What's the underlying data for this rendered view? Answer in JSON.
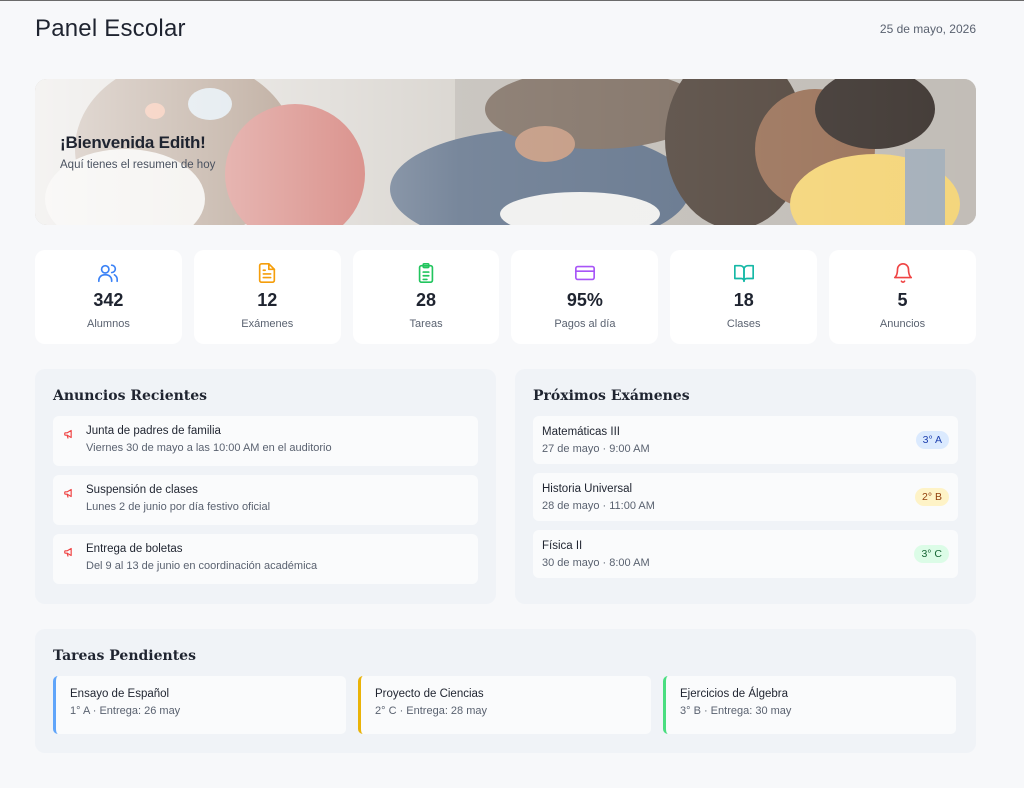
{
  "header": {
    "title": "Panel Escolar",
    "date": "25 de mayo, 2026"
  },
  "hero": {
    "title": "¡Bienvenida Edith!",
    "subtitle": "Aquí tienes el resumen de hoy"
  },
  "stats": [
    {
      "icon": "users-icon",
      "value": "342",
      "label": "Alumnos",
      "color": "#3b82f6"
    },
    {
      "icon": "document-icon",
      "value": "12",
      "label": "Exámenes",
      "color": "#f59e0b"
    },
    {
      "icon": "clipboard-icon",
      "value": "28",
      "label": "Tareas",
      "color": "#22c55e"
    },
    {
      "icon": "credit-card-icon",
      "value": "95%",
      "label": "Pagos al día",
      "color": "#a855f7"
    },
    {
      "icon": "book-icon",
      "value": "18",
      "label": "Clases",
      "color": "#14b8a6"
    },
    {
      "icon": "bell-icon",
      "value": "5",
      "label": "Anuncios",
      "color": "#ef4444"
    }
  ],
  "announcements": {
    "title": "Anuncios Recientes",
    "icon": "megaphone-icon",
    "icon_color": "#ef4444",
    "items": [
      {
        "title": "Junta de padres de familia",
        "detail": "Viernes 30 de mayo a las 10:00 AM en el auditorio"
      },
      {
        "title": "Suspensión de clases",
        "detail": "Lunes 2 de junio por día festivo oficial"
      },
      {
        "title": "Entrega de boletas",
        "detail": "Del 9 al 13 de junio en coordinación académica"
      }
    ]
  },
  "exams": {
    "title": "Próximos Exámenes",
    "items": [
      {
        "subject": "Matemáticas III",
        "when": "27 de mayo · 9:00 AM",
        "group": "3° A",
        "badge_bg": "#dbeafe",
        "badge_fg": "#1e40af"
      },
      {
        "subject": "Historia Universal",
        "when": "28 de mayo · 11:00 AM",
        "group": "2° B",
        "badge_bg": "#fef3c7",
        "badge_fg": "#92400e"
      },
      {
        "subject": "Física II",
        "when": "30 de mayo · 8:00 AM",
        "group": "3° C",
        "badge_bg": "#dcfce7",
        "badge_fg": "#166534"
      }
    ]
  },
  "tasks": {
    "title": "Tareas Pendientes",
    "items": [
      {
        "title": "Ensayo de Español",
        "detail": "1° A · Entrega: 26 may",
        "color": "#60a5fa"
      },
      {
        "title": "Proyecto de Ciencias",
        "detail": "2° C · Entrega: 28 may",
        "color": "#eab308"
      },
      {
        "title": "Ejercicios de Álgebra",
        "detail": "3° B · Entrega: 30 may",
        "color": "#4ade80"
      }
    ]
  }
}
